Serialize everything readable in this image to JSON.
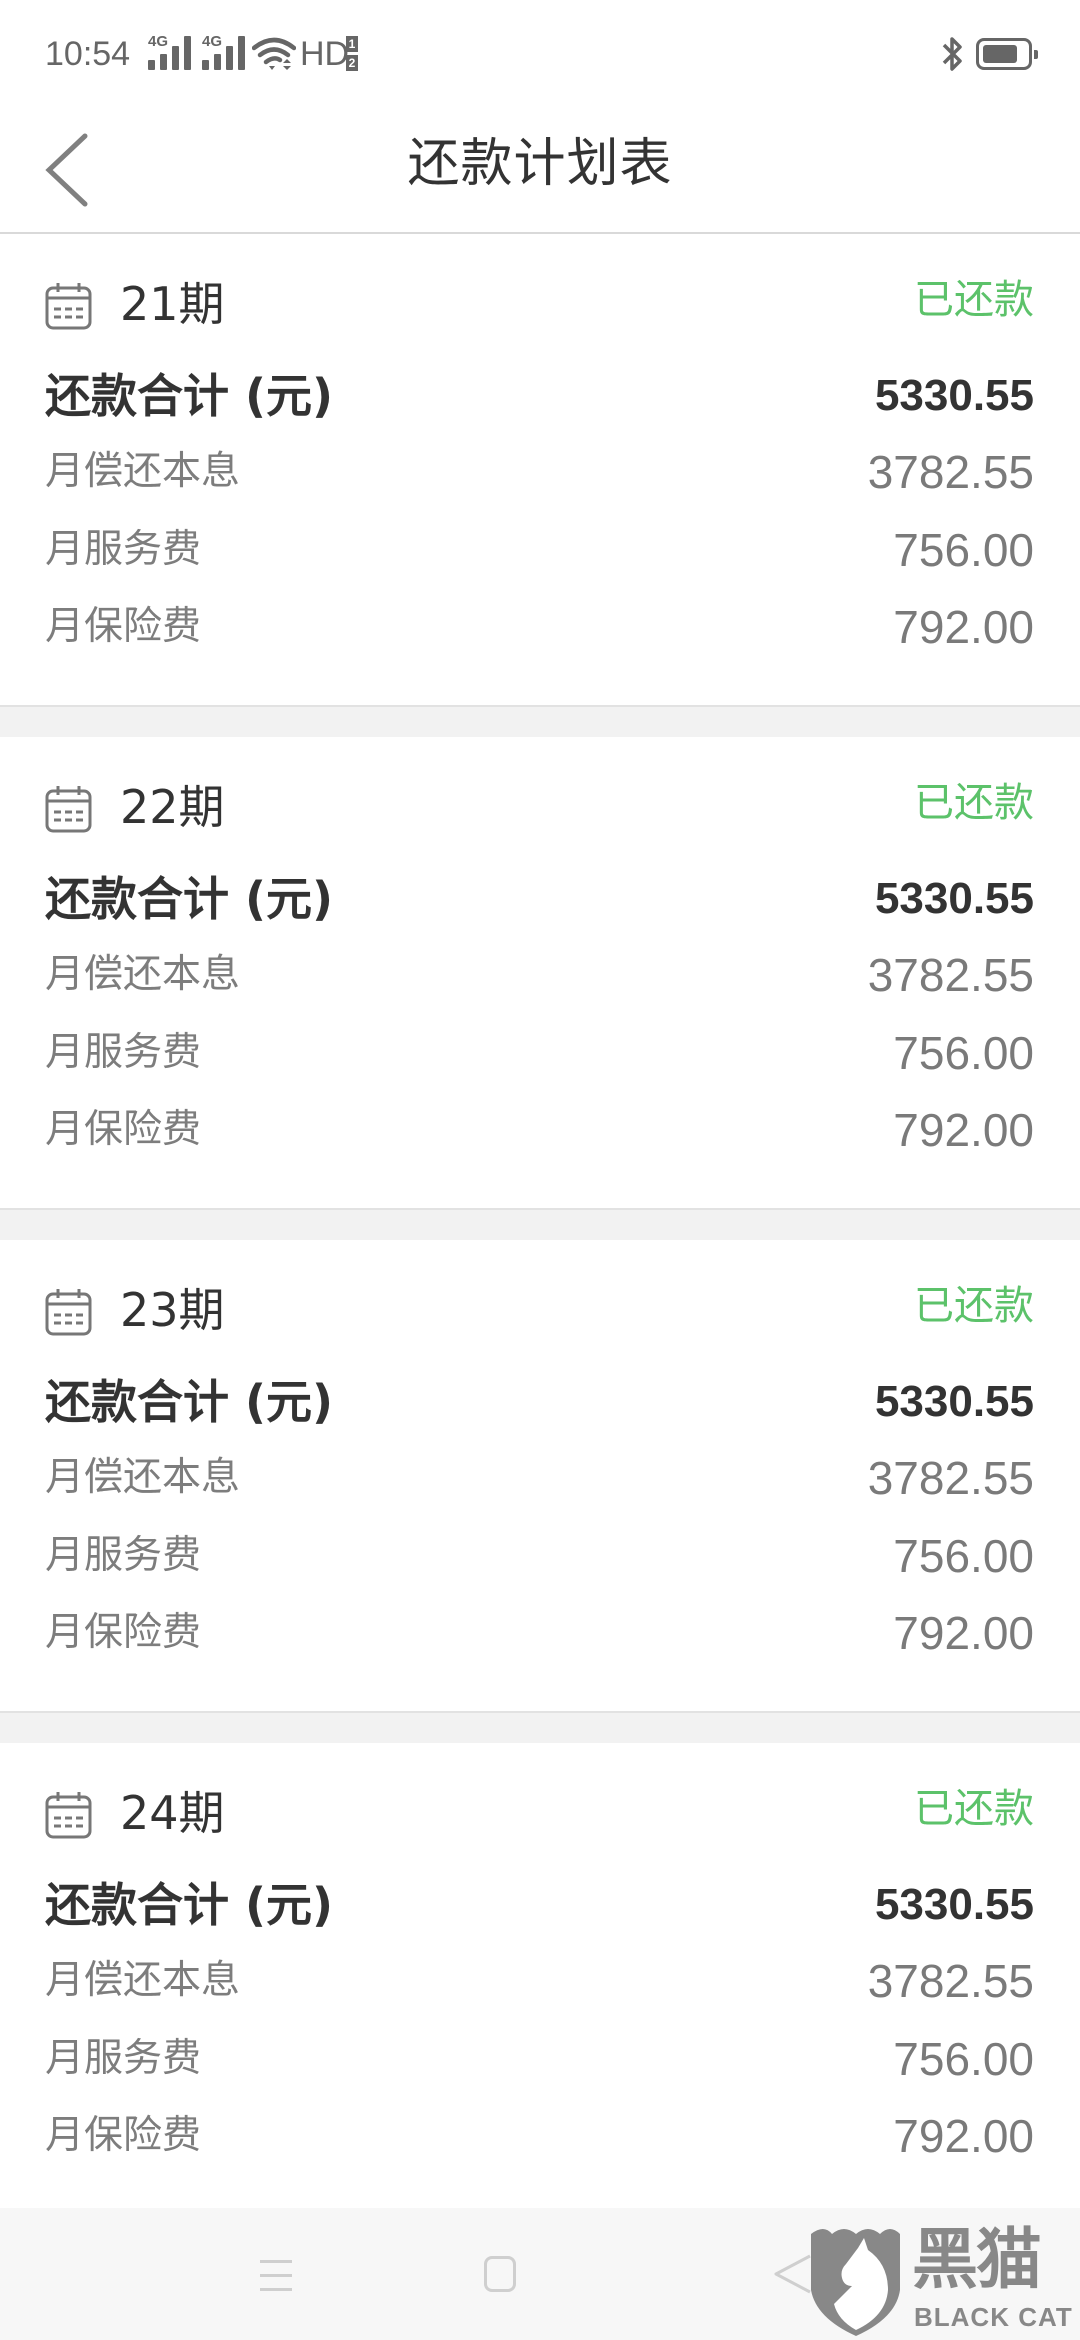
{
  "status_bar": {
    "time": "10:54",
    "sim1_network": "4G",
    "sim2_network": "4G",
    "hd_label": "HD",
    "hd_sims": [
      "1",
      "2"
    ],
    "icons": [
      "signal-icon",
      "signal-icon",
      "wifi-icon",
      "bluetooth-icon",
      "battery-icon"
    ]
  },
  "header": {
    "back_icon": "chevron-left-icon",
    "title": "还款计划表"
  },
  "theme": {
    "paid_color": "#5cc26a",
    "text_primary": "#333333",
    "text_secondary": "#7a7a7a",
    "divider_bg": "#f2f2f2"
  },
  "installments": [
    {
      "period": "21期",
      "status": "已还款",
      "total_label": "还款合计 (元)",
      "total": "5330.55",
      "items": [
        {
          "label": "月偿还本息",
          "value": "3782.55"
        },
        {
          "label": "月服务费",
          "value": "756.00"
        },
        {
          "label": "月保险费",
          "value": "792.00"
        }
      ]
    },
    {
      "period": "22期",
      "status": "已还款",
      "total_label": "还款合计 (元)",
      "total": "5330.55",
      "items": [
        {
          "label": "月偿还本息",
          "value": "3782.55"
        },
        {
          "label": "月服务费",
          "value": "756.00"
        },
        {
          "label": "月保险费",
          "value": "792.00"
        }
      ]
    },
    {
      "period": "23期",
      "status": "已还款",
      "total_label": "还款合计 (元)",
      "total": "5330.55",
      "items": [
        {
          "label": "月偿还本息",
          "value": "3782.55"
        },
        {
          "label": "月服务费",
          "value": "756.00"
        },
        {
          "label": "月保险费",
          "value": "792.00"
        }
      ]
    },
    {
      "period": "24期",
      "status": "已还款",
      "total_label": "还款合计 (元)",
      "total": "5330.55",
      "items": [
        {
          "label": "月偿还本息",
          "value": "3782.55"
        },
        {
          "label": "月服务费",
          "value": "756.00"
        },
        {
          "label": "月保险费",
          "value": "792.00"
        }
      ]
    }
  ],
  "nav_bar": {
    "icons": [
      "menu-icon",
      "home-icon",
      "back-icon"
    ]
  },
  "watermark": {
    "cn": "黑猫",
    "en": "BLACK CAT"
  }
}
